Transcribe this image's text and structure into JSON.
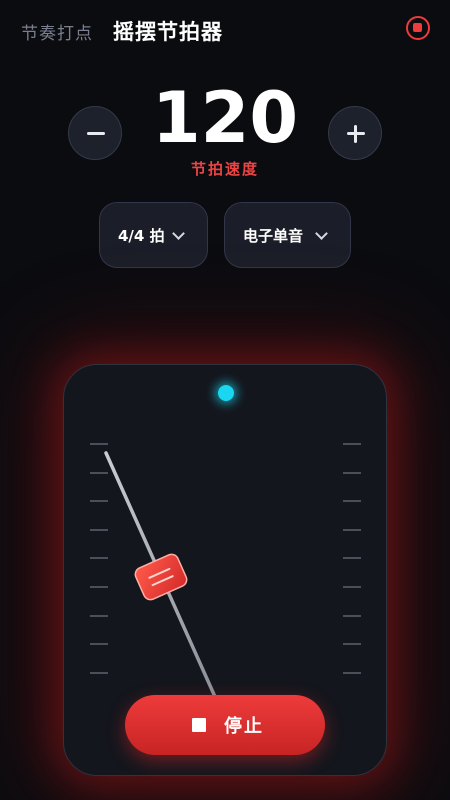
{
  "header": {
    "tab_rhythm": "节奏打点",
    "tab_metronome": "摇摆节拍器"
  },
  "tempo": {
    "bpm": "120",
    "label": "节拍速度"
  },
  "controls": {
    "time_signature": "4/4 拍",
    "sound": "电子单音"
  },
  "pendulum": {
    "tick_count_per_side": 9
  },
  "stop_button": {
    "label": "停止"
  },
  "colors": {
    "accent": "#ef4444",
    "beat_indicator": "#1ad6f0",
    "background": "#0b0c10"
  }
}
